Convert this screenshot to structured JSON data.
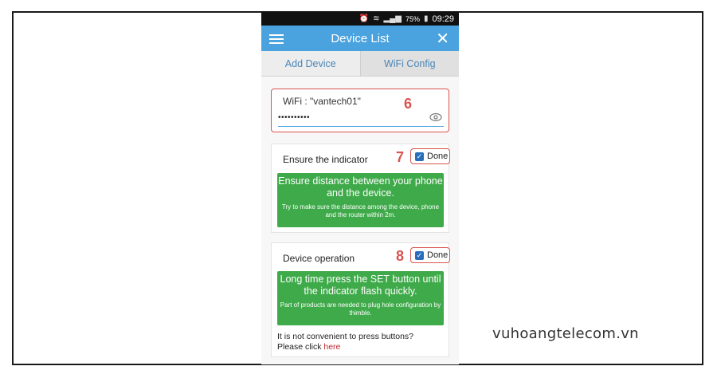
{
  "status_bar": {
    "battery": "75%",
    "time": "09:29"
  },
  "titlebar": {
    "title": "Device List",
    "close_glyph": "✕"
  },
  "tabs": [
    {
      "label": "Add Device"
    },
    {
      "label": "WiFi Config"
    }
  ],
  "wifi": {
    "label": "WiFi : \"vantech01\"",
    "password_mask": "••••••••••",
    "step": "6"
  },
  "steps": [
    {
      "number": "7",
      "heading": "Ensure the indicator",
      "done_label": "Done",
      "main_text": "Ensure distance between your phone and the device.",
      "sub_text": "Try to make sure the distance among the device, phone and the router within 2m."
    },
    {
      "number": "8",
      "heading": "Device operation",
      "done_label": "Done",
      "main_text": "Long time press the SET button until the indicator flash quickly.",
      "sub_text": "Part of products are needed to plug hole configuration by thimble."
    }
  ],
  "hint": {
    "text": "It is not convenient to press buttons?",
    "prefix": "Please click ",
    "link": "here"
  },
  "watermark": "vuhoangtelecom.vn",
  "colors": {
    "accent": "#4aa3df",
    "green": "#3eaa49",
    "highlight": "#d9534f"
  }
}
